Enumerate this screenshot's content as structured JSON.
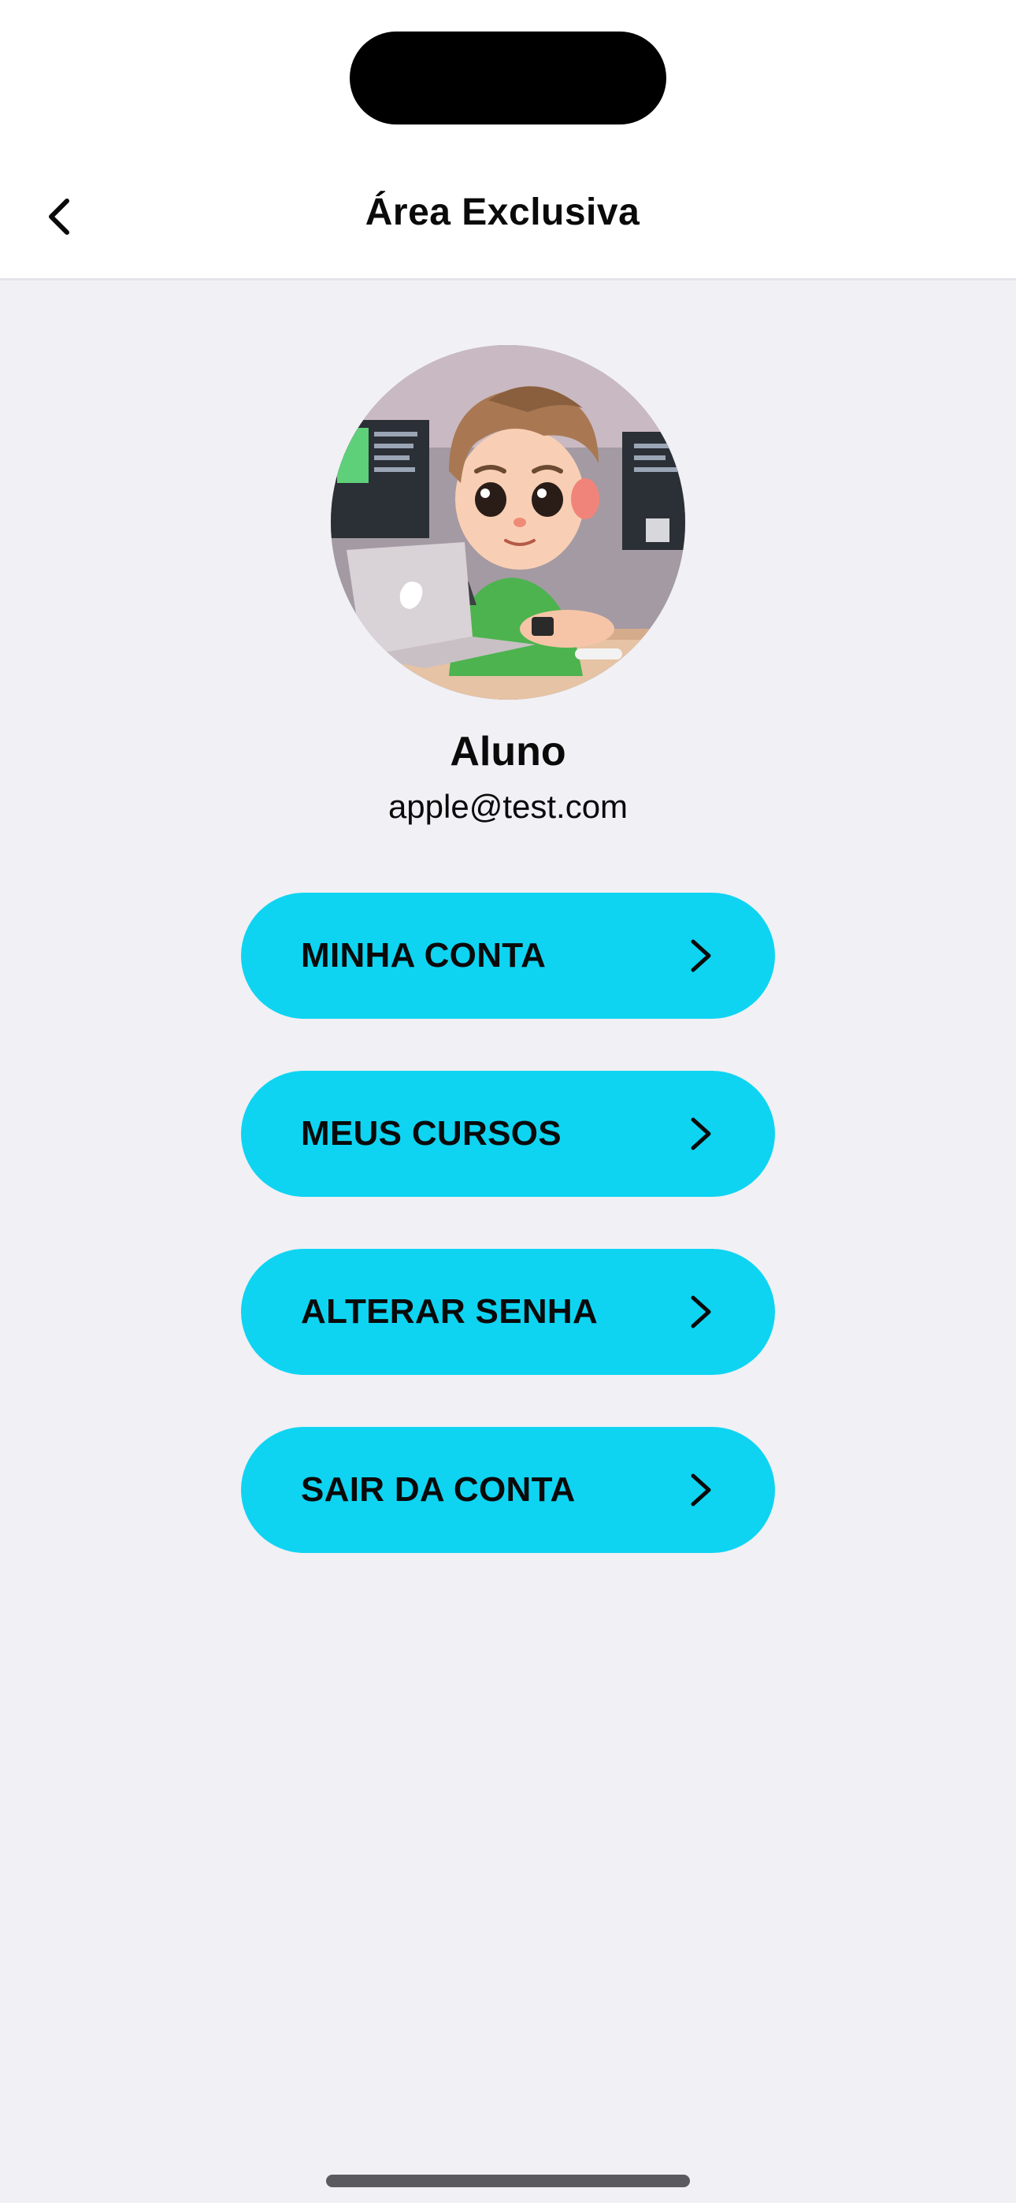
{
  "header": {
    "title": "Área Exclusiva",
    "back_icon": "chevron-left-icon"
  },
  "profile": {
    "avatar_alt": "avatar",
    "name": "Aluno",
    "email": "apple@test.com"
  },
  "menu": [
    {
      "label": "MINHA CONTA",
      "icon": "chevron-right-icon"
    },
    {
      "label": "MEUS CURSOS",
      "icon": "chevron-right-icon"
    },
    {
      "label": "ALTERAR SENHA",
      "icon": "chevron-right-icon"
    },
    {
      "label": "SAIR DA CONTA",
      "icon": "chevron-right-icon"
    }
  ],
  "colors": {
    "accent": "#0ed4f2",
    "background": "#f0f0f5",
    "header_bg": "#ffffff",
    "text": "#0a0a0a"
  }
}
